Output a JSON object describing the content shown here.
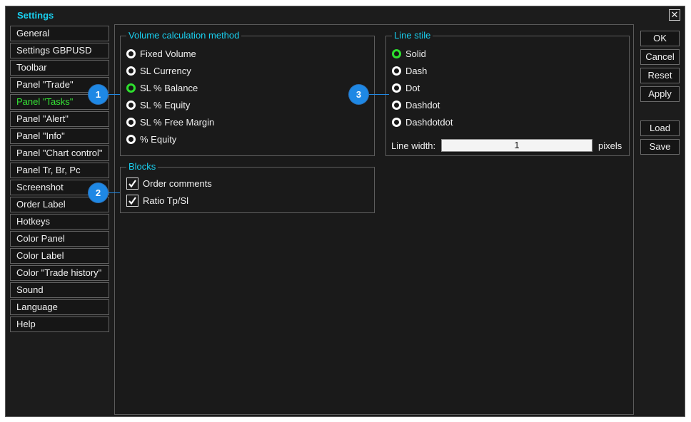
{
  "window": {
    "title": "Settings",
    "close_symbol": "✕"
  },
  "sidebar": {
    "items": [
      {
        "label": "General",
        "active": false
      },
      {
        "label": "Settings GBPUSD",
        "active": false
      },
      {
        "label": "Toolbar",
        "active": false
      },
      {
        "label": "Panel \"Trade\"",
        "active": false
      },
      {
        "label": "Panel \"Tasks\"",
        "active": true
      },
      {
        "label": "Panel \"Alert\"",
        "active": false
      },
      {
        "label": "Panel \"Info\"",
        "active": false
      },
      {
        "label": "Panel \"Chart control\"",
        "active": false
      },
      {
        "label": "Panel Tr, Br, Pc",
        "active": false
      },
      {
        "label": "Screenshot",
        "active": false
      },
      {
        "label": "Order Label",
        "active": false
      },
      {
        "label": "Hotkeys",
        "active": false
      },
      {
        "label": "Color Panel",
        "active": false
      },
      {
        "label": "Color Label",
        "active": false
      },
      {
        "label": "Color \"Trade history\"",
        "active": false
      },
      {
        "label": "Sound",
        "active": false
      },
      {
        "label": "Language",
        "active": false
      },
      {
        "label": "Help",
        "active": false
      }
    ]
  },
  "volume_group": {
    "title": "Volume calculation method",
    "options": [
      {
        "label": "Fixed Volume",
        "selected": false
      },
      {
        "label": "SL Currency",
        "selected": false
      },
      {
        "label": "SL % Balance",
        "selected": true
      },
      {
        "label": "SL % Equity",
        "selected": false
      },
      {
        "label": "SL % Free Margin",
        "selected": false
      },
      {
        "label": "% Equity",
        "selected": false
      }
    ]
  },
  "blocks_group": {
    "title": "Blocks",
    "options": [
      {
        "label": "Order comments",
        "checked": true
      },
      {
        "label": "Ratio Tp/Sl",
        "checked": true
      }
    ]
  },
  "line_group": {
    "title": "Line stile",
    "options": [
      {
        "label": "Solid",
        "selected": true
      },
      {
        "label": "Dash",
        "selected": false
      },
      {
        "label": "Dot",
        "selected": false
      },
      {
        "label": "Dashdot",
        "selected": false
      },
      {
        "label": "Dashdotdot",
        "selected": false
      }
    ],
    "width_label": "Line width:",
    "width_value": "1",
    "width_unit": "pixels"
  },
  "buttons": {
    "ok": "OK",
    "cancel": "Cancel",
    "reset": "Reset",
    "apply": "Apply",
    "load": "Load",
    "save": "Save"
  },
  "callouts": [
    "1",
    "2",
    "3"
  ],
  "colors": {
    "accent_title": "#19d0f0",
    "active_item": "#35e335",
    "selected_radio": "#2ee02e",
    "callout": "#1e88e5",
    "background": "#1c1c1c"
  }
}
